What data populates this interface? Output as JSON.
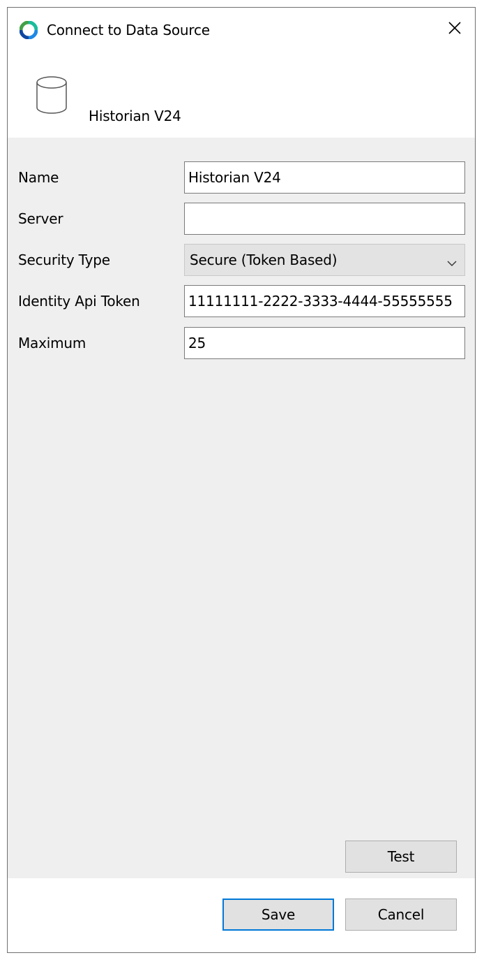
{
  "window": {
    "title": "Connect to Data Source",
    "app_icon": "app-ring-icon",
    "close_icon": "close-icon"
  },
  "header": {
    "icon": "database-icon",
    "name": "Historian V24"
  },
  "form": {
    "name_label": "Name",
    "name_value": "Historian V24",
    "server_label": "Server",
    "server_value": "",
    "security_label": "Security Type",
    "security_value": "Secure (Token Based)",
    "token_label": "Identity Api Token",
    "token_value": "11111111-2222-3333-4444-55555555",
    "maximum_label": "Maximum",
    "maximum_value": "25"
  },
  "buttons": {
    "test": "Test",
    "save": "Save",
    "cancel": "Cancel"
  },
  "colors": {
    "accent": "#0078d7",
    "content_bg": "#efefef",
    "button_bg": "#e1e1e1"
  }
}
